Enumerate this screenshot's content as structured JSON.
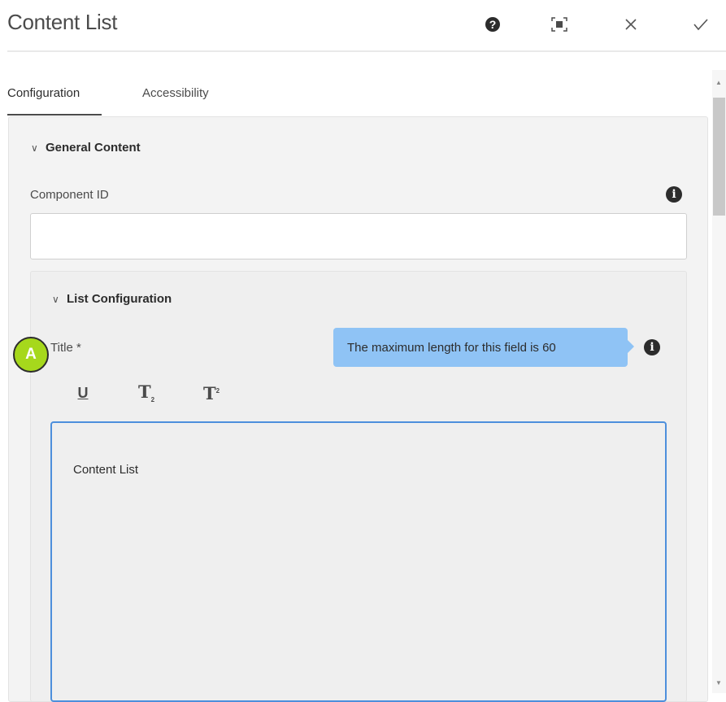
{
  "dialog": {
    "title": "Content List",
    "help_icon": "help-circle-icon",
    "fullscreen_icon": "fullscreen-icon",
    "close_icon": "close-icon",
    "done_icon": "checkmark-icon"
  },
  "tabs": [
    {
      "label": "Configuration",
      "active": true
    },
    {
      "label": "Accessibility",
      "active": false
    }
  ],
  "general_content": {
    "heading": "General Content",
    "component_id": {
      "label": "Component ID",
      "value": ""
    }
  },
  "list_configuration": {
    "heading": "List Configuration",
    "title_field": {
      "label": "Title *",
      "tooltip": "The maximum length for this field is 60",
      "value": "Content List"
    },
    "toolbar": {
      "underline": "U",
      "subscript": "T",
      "subscript_sub": "2",
      "superscript": "T",
      "superscript_sup": "2"
    }
  },
  "annotation": {
    "marker_label": "A",
    "marker_color": "#a6d81c"
  },
  "colors": {
    "tooltip_bg": "#8fc3f5",
    "focus_border": "#4d8fdc"
  }
}
